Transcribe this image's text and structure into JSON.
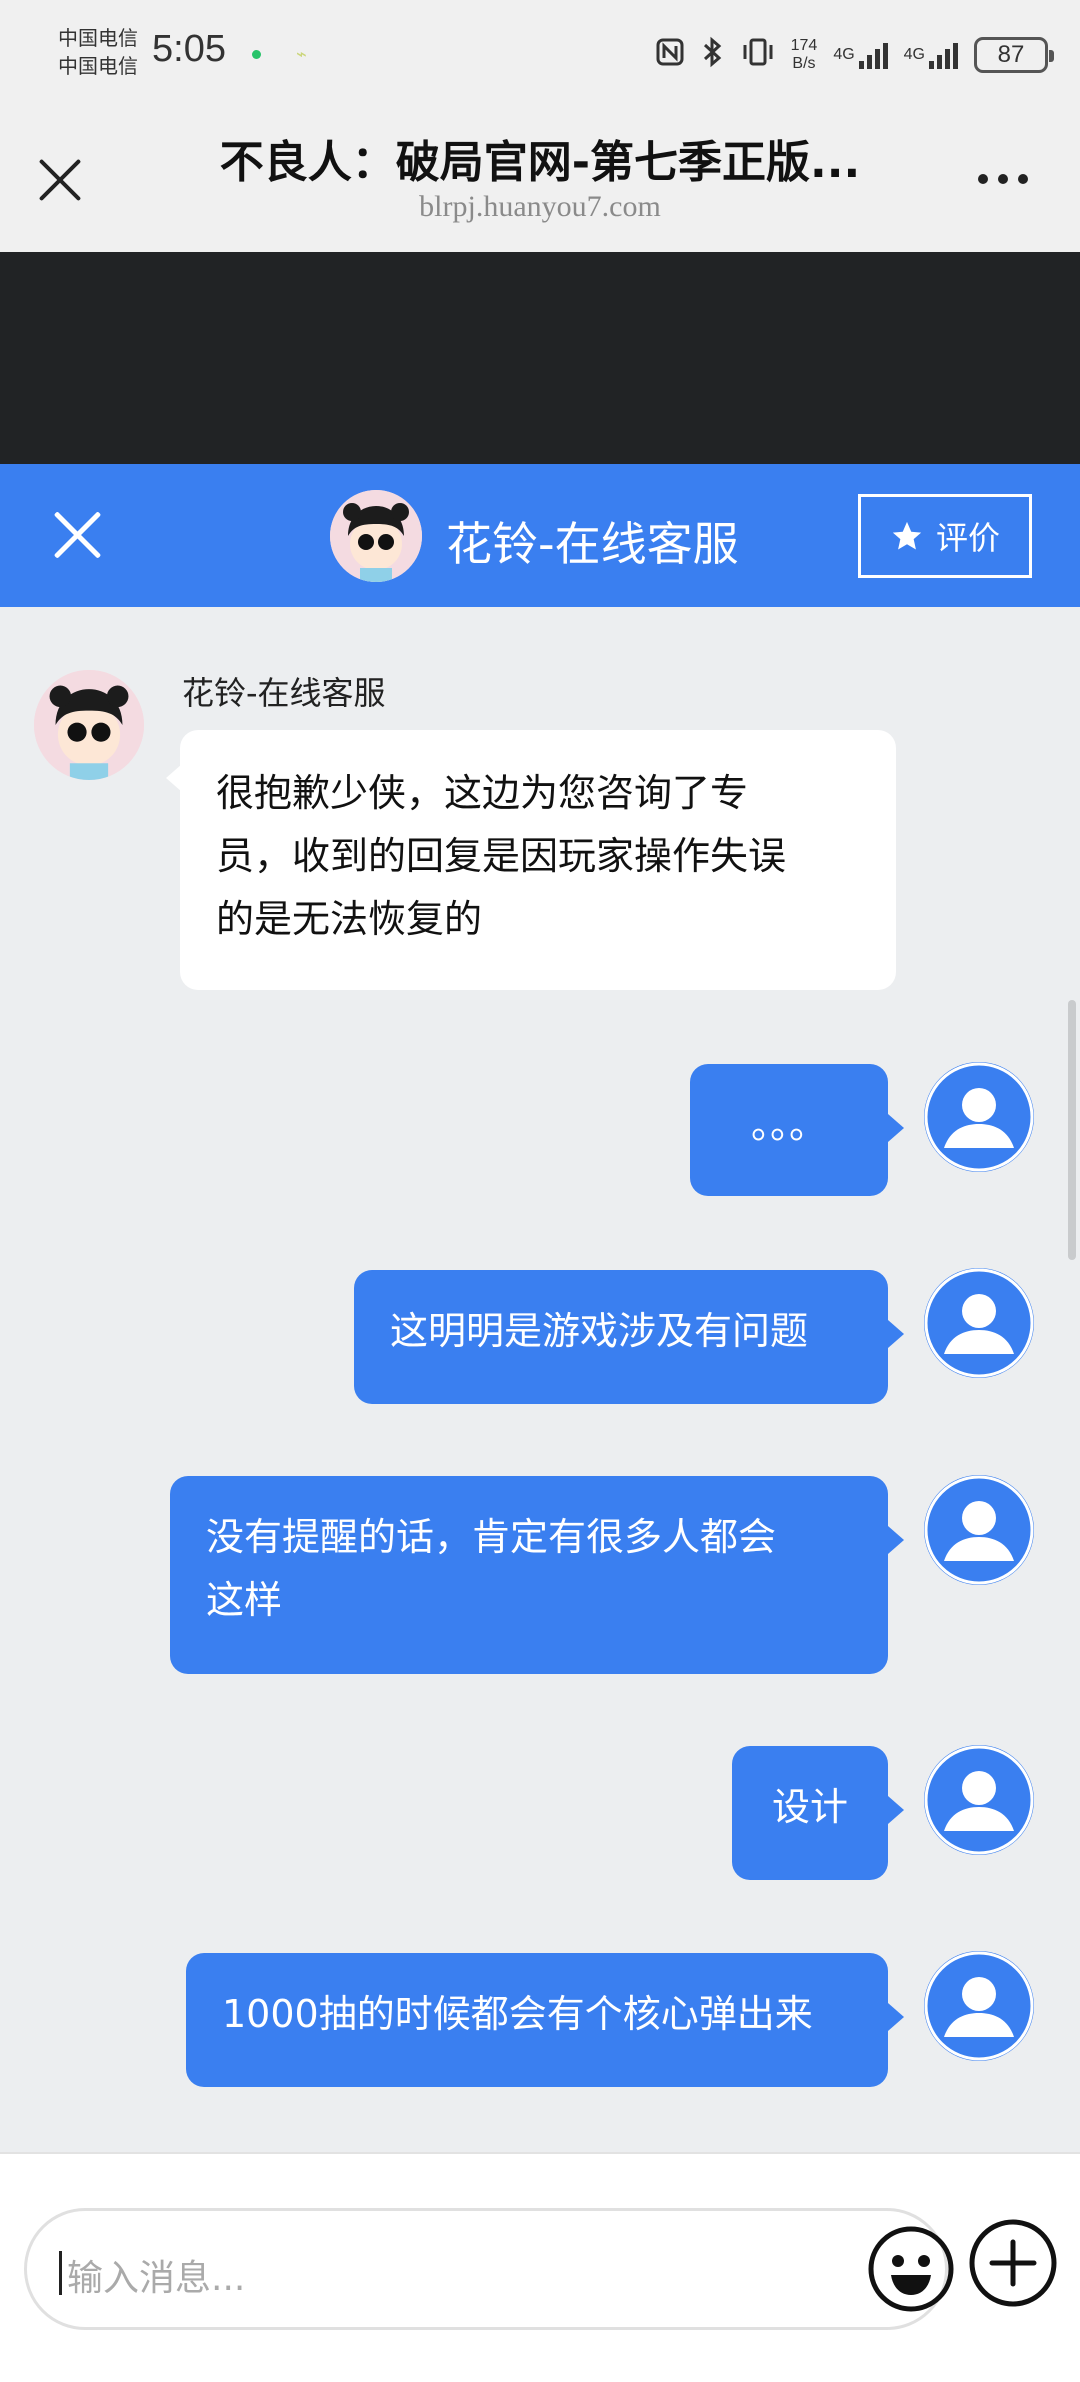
{
  "status_bar": {
    "carrier_1": "中国电信",
    "carrier_2": "中国电信",
    "time": "5:05",
    "net_speed_value": "174",
    "net_speed_unit": "B/s",
    "signal_1_label": "4G",
    "signal_2_label": "4G",
    "battery": "87"
  },
  "browser": {
    "title": "不良人：破局官网-第七季正版...",
    "url": "blrpj.huanyou7.com"
  },
  "chat": {
    "title": "花铃-在线客服",
    "rate_label": "评价"
  },
  "messages": {
    "agent_name": "花铃-在线客服",
    "agent_1": [
      "很抱歉少侠，这边为您咨询了专",
      "员，收到的回复是因玩家操作失误",
      "的是无法恢复的"
    ],
    "user_1": "。。。",
    "user_2": "这明明是游戏涉及有问题",
    "user_3": [
      "没有提醒的话，肯定有很多人都会",
      "这样"
    ],
    "user_4": "设计",
    "user_5": "1000抽的时候都会有个核心弹出来"
  },
  "input": {
    "placeholder": "输入消息..."
  },
  "colors": {
    "accent": "#3a7ff0",
    "dark_band": "#212325",
    "background": "#eceef0"
  }
}
